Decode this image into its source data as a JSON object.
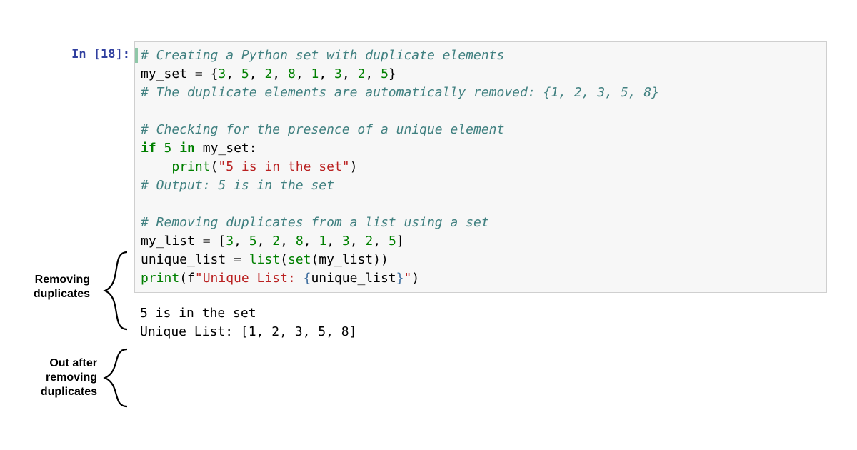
{
  "prompt": "In [18]:",
  "code": {
    "l1_comment": "# Creating a Python set with duplicate elements",
    "l2_pre": "my_set ",
    "l2_eq": "=",
    "l2_set": " {",
    "l2_n1": "3",
    "l2_c1": ", ",
    "l2_n2": "5",
    "l2_c2": ", ",
    "l2_n3": "2",
    "l2_c3": ", ",
    "l2_n4": "8",
    "l2_c4": ", ",
    "l2_n5": "1",
    "l2_c5": ", ",
    "l2_n6": "3",
    "l2_c6": ", ",
    "l2_n7": "2",
    "l2_c7": ", ",
    "l2_n8": "5",
    "l2_close": "}",
    "l3_comment": "# The duplicate elements are automatically removed: {1, 2, 3, 5, 8}",
    "l5_comment": "# Checking for the presence of a unique element",
    "l6_if": "if",
    "l6_sp1": " ",
    "l6_num": "5",
    "l6_sp2": " ",
    "l6_in": "in",
    "l6_sp3": " my_set:",
    "l7_indent": "    ",
    "l7_print": "print",
    "l7_open": "(",
    "l7_str": "\"5 is in the set\"",
    "l7_close": ")",
    "l8_comment": "# Output: 5 is in the set",
    "l10_comment": "# Removing duplicates from a list using a set",
    "l11_pre": "my_list ",
    "l11_eq": "=",
    "l11_open": " [",
    "l11_n1": "3",
    "l11_c1": ", ",
    "l11_n2": "5",
    "l11_c2": ", ",
    "l11_n3": "2",
    "l11_c3": ", ",
    "l11_n4": "8",
    "l11_c4": ", ",
    "l11_n5": "1",
    "l11_c5": ", ",
    "l11_n6": "3",
    "l11_c6": ", ",
    "l11_n7": "2",
    "l11_c7": ", ",
    "l11_n8": "5",
    "l11_close": "]",
    "l12_pre": "unique_list ",
    "l12_eq": "=",
    "l12_sp": " ",
    "l12_list": "list",
    "l12_open": "(",
    "l12_set": "set",
    "l12_open2": "(my_list))",
    "l13_print": "print",
    "l13_open": "(f",
    "l13_str": "\"Unique List: ",
    "l13_interp_open": "{",
    "l13_var": "unique_list",
    "l13_interp_close": "}",
    "l13_str_close": "\"",
    "l13_close": ")"
  },
  "output": {
    "line1": "5 is in the set",
    "line2": "Unique List: [1, 2, 3, 5, 8]"
  },
  "annotations": {
    "label1_l1": "Removing",
    "label1_l2": "duplicates",
    "label2_l1": "Out after",
    "label2_l2": "removing",
    "label2_l3": "duplicates"
  }
}
